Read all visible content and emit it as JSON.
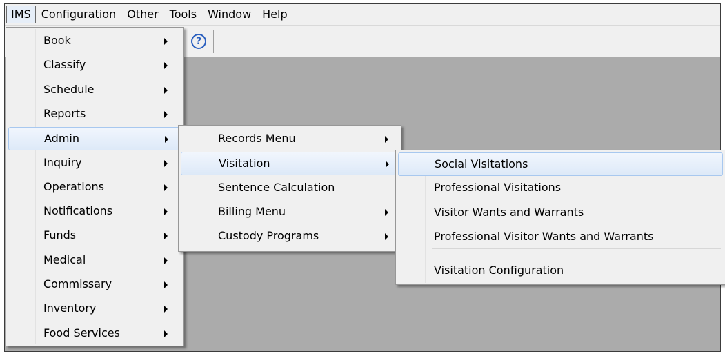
{
  "menubar": {
    "items": [
      "IMS",
      "Configuration",
      "Other",
      "Tools",
      "Window",
      "Help"
    ],
    "active_index": 0
  },
  "toolbar": {
    "help_icon": "help-circle-icon",
    "help_glyph": "?"
  },
  "menu_main": {
    "items": [
      {
        "label": "Book",
        "submenu": true
      },
      {
        "label": "Classify",
        "submenu": true
      },
      {
        "label": "Schedule",
        "submenu": true
      },
      {
        "label": "Reports",
        "submenu": true
      },
      {
        "label": "Admin",
        "submenu": true,
        "highlighted": true
      },
      {
        "label": "Inquiry",
        "submenu": true
      },
      {
        "label": "Operations",
        "submenu": true
      },
      {
        "label": "Notifications",
        "submenu": true
      },
      {
        "label": "Funds",
        "submenu": true
      },
      {
        "label": "Medical",
        "submenu": true
      },
      {
        "label": "Commissary",
        "submenu": true
      },
      {
        "label": "Inventory",
        "submenu": true
      },
      {
        "label": "Food Services",
        "submenu": true
      }
    ]
  },
  "menu_admin": {
    "items": [
      {
        "label": "Records Menu",
        "submenu": true
      },
      {
        "label": "Visitation",
        "submenu": true,
        "highlighted": true
      },
      {
        "label": "Sentence Calculation",
        "submenu": false
      },
      {
        "label": "Billing Menu",
        "submenu": true
      },
      {
        "label": "Custody Programs",
        "submenu": true
      }
    ]
  },
  "menu_visitation": {
    "items": [
      {
        "label": "Social Visitations",
        "highlighted": true
      },
      {
        "label": "Professional Visitations"
      },
      {
        "label": "Visitor Wants and Warrants"
      },
      {
        "label": "Professional Visitor Wants and Warrants"
      },
      {
        "label": "Visitation Configuration"
      }
    ]
  },
  "colors": {
    "workspace": "#ababab",
    "menu_bg": "#f0f0f0",
    "highlight_border": "#a8c8ef",
    "help_blue": "#2a5fbf"
  }
}
